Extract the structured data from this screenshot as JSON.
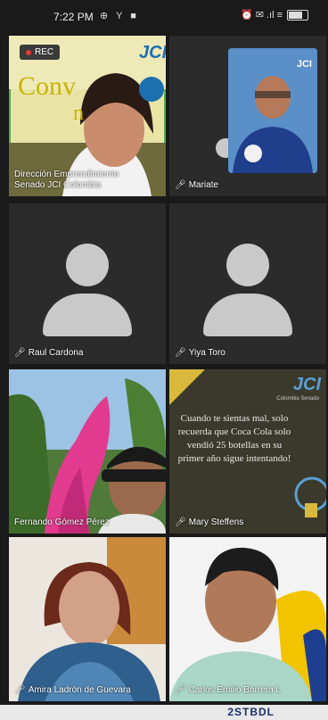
{
  "status": {
    "time": "7:22 PM",
    "left_icons": "⊕ Y ■",
    "right_icons": "⏰ ✉ .ıl ≡"
  },
  "recording": {
    "label": "REC"
  },
  "tiles": [
    {
      "name_line1": "Dirección Emprendimiento",
      "name_line2": "Senado JCI Colombia",
      "overlay_text": "Conv",
      "overlay_text2": "n",
      "logo": "JCI"
    },
    {
      "name": "Mariate",
      "logo": "JCI"
    },
    {
      "name": "Raul Cardona"
    },
    {
      "name": "Yiya Toro"
    },
    {
      "name": "Fernando Gómez Pérez"
    },
    {
      "name": "Mary Steffens",
      "logo": "JCI",
      "logo_sub": "Colombia Senado",
      "quote": "Cuando te sientas mal, solo recuerda que Coca Cola solo vendió 25 botellas en su primer año sigue intentando!"
    },
    {
      "name": "Amira Ladrón de Guevara"
    },
    {
      "name": "Carlos Emilio Barrera L"
    }
  ],
  "bottom": {
    "text": "2STBDL"
  }
}
